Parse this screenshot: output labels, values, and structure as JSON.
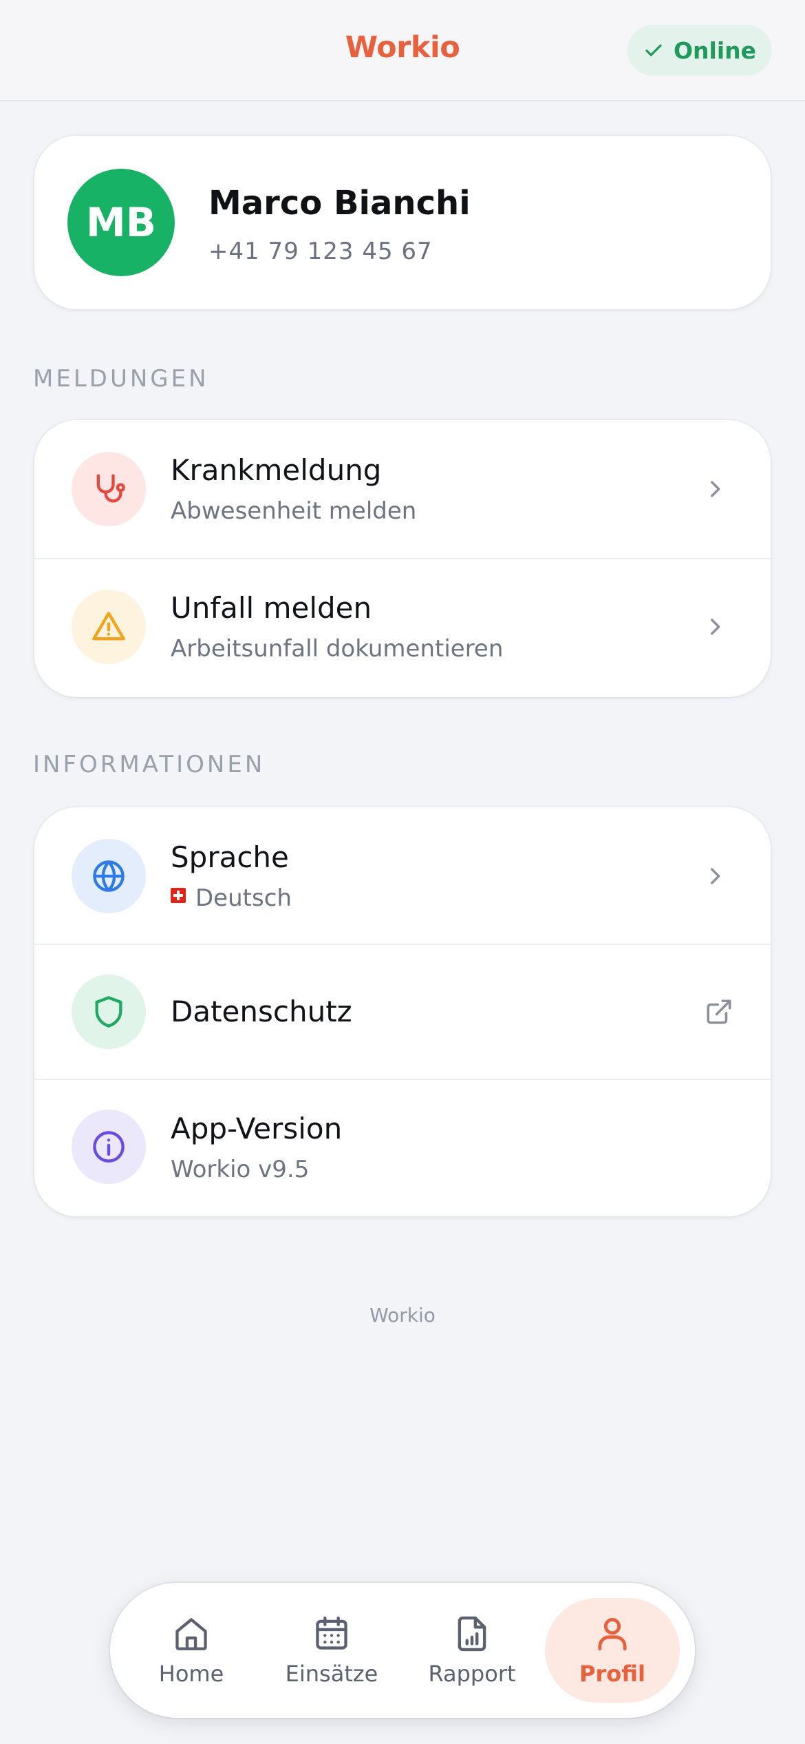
{
  "header": {
    "title": "Workio",
    "status": {
      "label": "Online",
      "icon": "check-icon",
      "color": "#1f9a5a"
    }
  },
  "profile": {
    "initials": "MB",
    "name": "Marco Bianchi",
    "phone": "+41 79 123 45 67",
    "avatar_color": "#18b266"
  },
  "sections": {
    "meldungen": {
      "label": "MELDUNGEN",
      "items": [
        {
          "title": "Krankmeldung",
          "subtitle": "Abwesenheit melden",
          "icon": "stethoscope-icon",
          "action": "chevron-right-icon"
        },
        {
          "title": "Unfall melden",
          "subtitle": "Arbeitsunfall dokumentieren",
          "icon": "warning-icon",
          "action": "chevron-right-icon"
        }
      ]
    },
    "informationen": {
      "label": "INFORMATIONEN",
      "items": [
        {
          "title": "Sprache",
          "subtitle": "Deutsch",
          "icon": "globe-icon",
          "flag": "swiss-flag-icon",
          "action": "chevron-right-icon"
        },
        {
          "title": "Datenschutz",
          "icon": "shield-icon",
          "action": "external-link-icon"
        },
        {
          "title": "App-Version",
          "subtitle": "Workio v9.5",
          "icon": "info-icon"
        }
      ]
    }
  },
  "footer": {
    "brand": "Workio"
  },
  "bottom_nav": {
    "items": [
      {
        "label": "Home",
        "icon": "home-icon",
        "active": false
      },
      {
        "label": "Einsätze",
        "icon": "calendar-icon",
        "active": false
      },
      {
        "label": "Rapport",
        "icon": "report-icon",
        "active": false
      },
      {
        "label": "Profil",
        "icon": "user-icon",
        "active": true
      }
    ]
  },
  "colors": {
    "accent": "#e8603c",
    "success": "#1f9a5a"
  }
}
